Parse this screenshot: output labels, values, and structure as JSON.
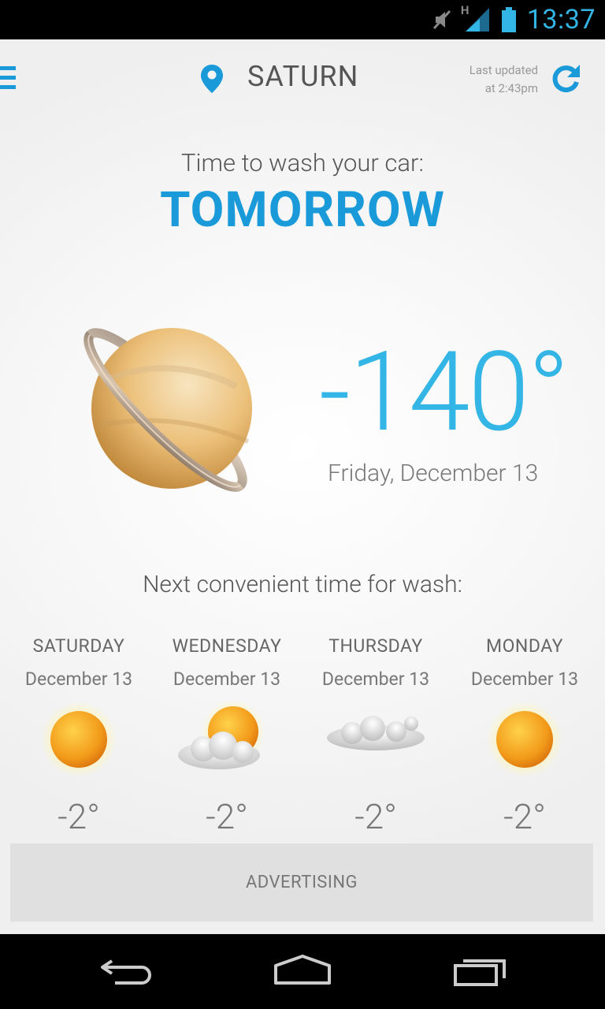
{
  "status_bar": {
    "time": "13:37",
    "network_label": "H",
    "icons": [
      "mute-icon",
      "signal-icon",
      "battery-icon"
    ]
  },
  "header": {
    "location": "SATURN",
    "last_updated_line1": "Last updated",
    "last_updated_line2": "at 2:43pm"
  },
  "main": {
    "headline_label": "Time to wash your car:",
    "headline_value": "TOMORROW",
    "temperature": "-140°",
    "date": "Friday, December 13",
    "planet_icon": "saturn-icon"
  },
  "forecast": {
    "label": "Next convenient time for wash:",
    "days": [
      {
        "name": "SATURDAY",
        "date": "December 13",
        "temp": "-2°",
        "icon": "sun-icon"
      },
      {
        "name": "WEDNESDAY",
        "date": "December 13",
        "temp": "-2°",
        "icon": "partly-cloudy-icon"
      },
      {
        "name": "THURSDAY",
        "date": "December 13",
        "temp": "-2°",
        "icon": "cloud-icon"
      },
      {
        "name": "MONDAY",
        "date": "December 13",
        "temp": "-2°",
        "icon": "sun-icon"
      }
    ]
  },
  "ad": {
    "label": "ADVERTISING"
  },
  "colors": {
    "accent": "#1a9ad9",
    "accent_light": "#33b5e5"
  }
}
